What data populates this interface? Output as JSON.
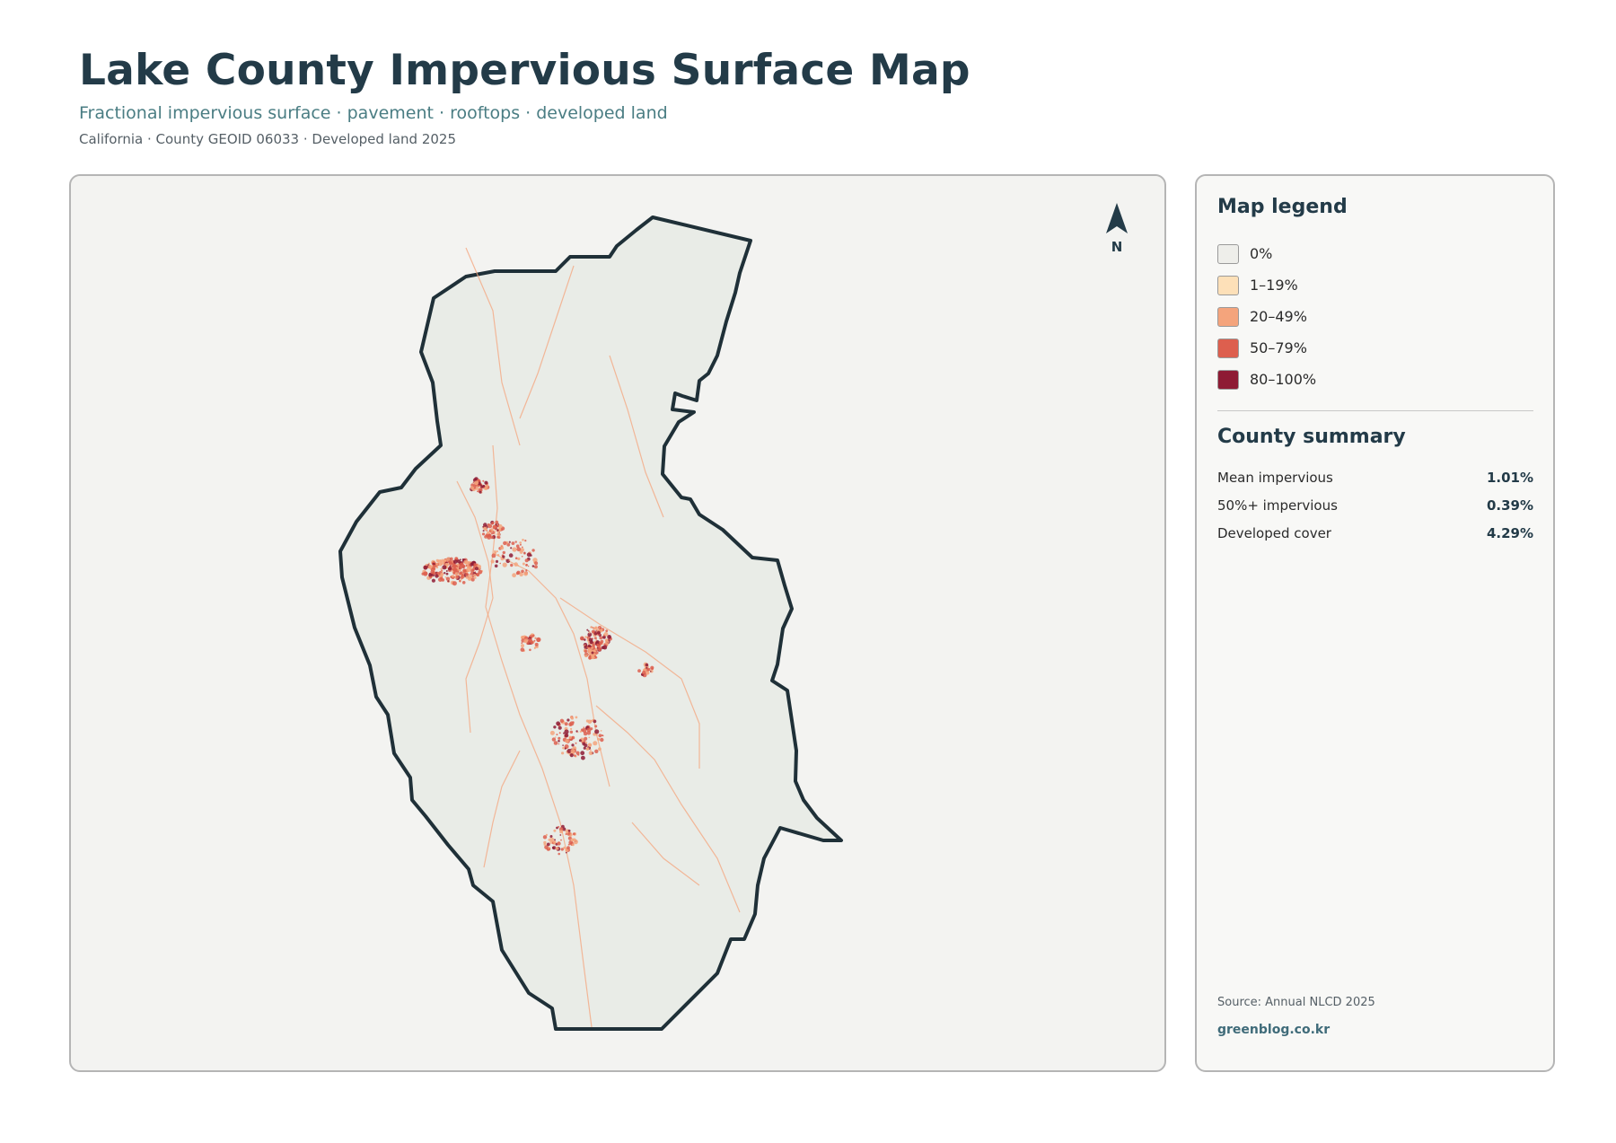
{
  "header": {
    "title": "Lake County Impervious Surface Map",
    "subtitle": "Fractional impervious surface · pavement · rooftops · developed land",
    "meta": "California · County GEOID 06033 · Developed land 2025"
  },
  "map": {
    "north_label": "N",
    "fill_color": "#e9ece7",
    "outline_color": "#1f3038"
  },
  "legend": {
    "title": "Map legend",
    "items": [
      {
        "label": "0%",
        "color": "#eeeeea"
      },
      {
        "label": "1–19%",
        "color": "#fde0b8"
      },
      {
        "label": "20–49%",
        "color": "#f4a47c"
      },
      {
        "label": "50–79%",
        "color": "#dd5f4e"
      },
      {
        "label": "80–100%",
        "color": "#8e1b34"
      }
    ]
  },
  "summary": {
    "title": "County summary",
    "rows": [
      {
        "label": "Mean impervious",
        "value": "1.01%"
      },
      {
        "label": "50%+ impervious",
        "value": "0.39%"
      },
      {
        "label": "Developed cover",
        "value": "4.29%"
      }
    ]
  },
  "footer": {
    "source": "Source: Annual NLCD 2025",
    "site": "greenblog.co.kr"
  }
}
